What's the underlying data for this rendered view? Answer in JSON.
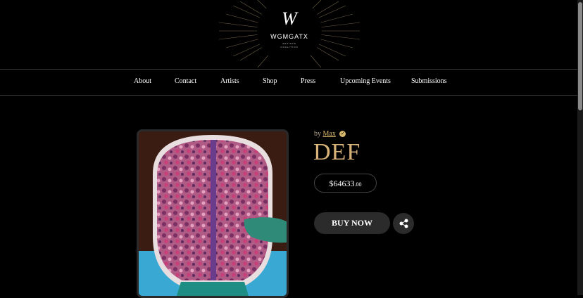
{
  "logo": {
    "letter": "W",
    "name": "WGMGATX",
    "tagline1": "ARTISTS",
    "tagline2": "COALITION"
  },
  "nav": [
    "About",
    "Contact",
    "Artists",
    "Shop",
    "Press",
    "Upcoming Events",
    "Submissions"
  ],
  "product": {
    "by_label": "by",
    "artist": "Max",
    "title": "DEF",
    "price_main": "$64633",
    "price_cents": ".00",
    "buy_label": "BUY NOW"
  },
  "colors": {
    "accent": "#d9b27a",
    "button": "#2b2b2b",
    "background": "#000000"
  },
  "icons": {
    "verified": "verified-check-icon",
    "share": "share-icon"
  }
}
